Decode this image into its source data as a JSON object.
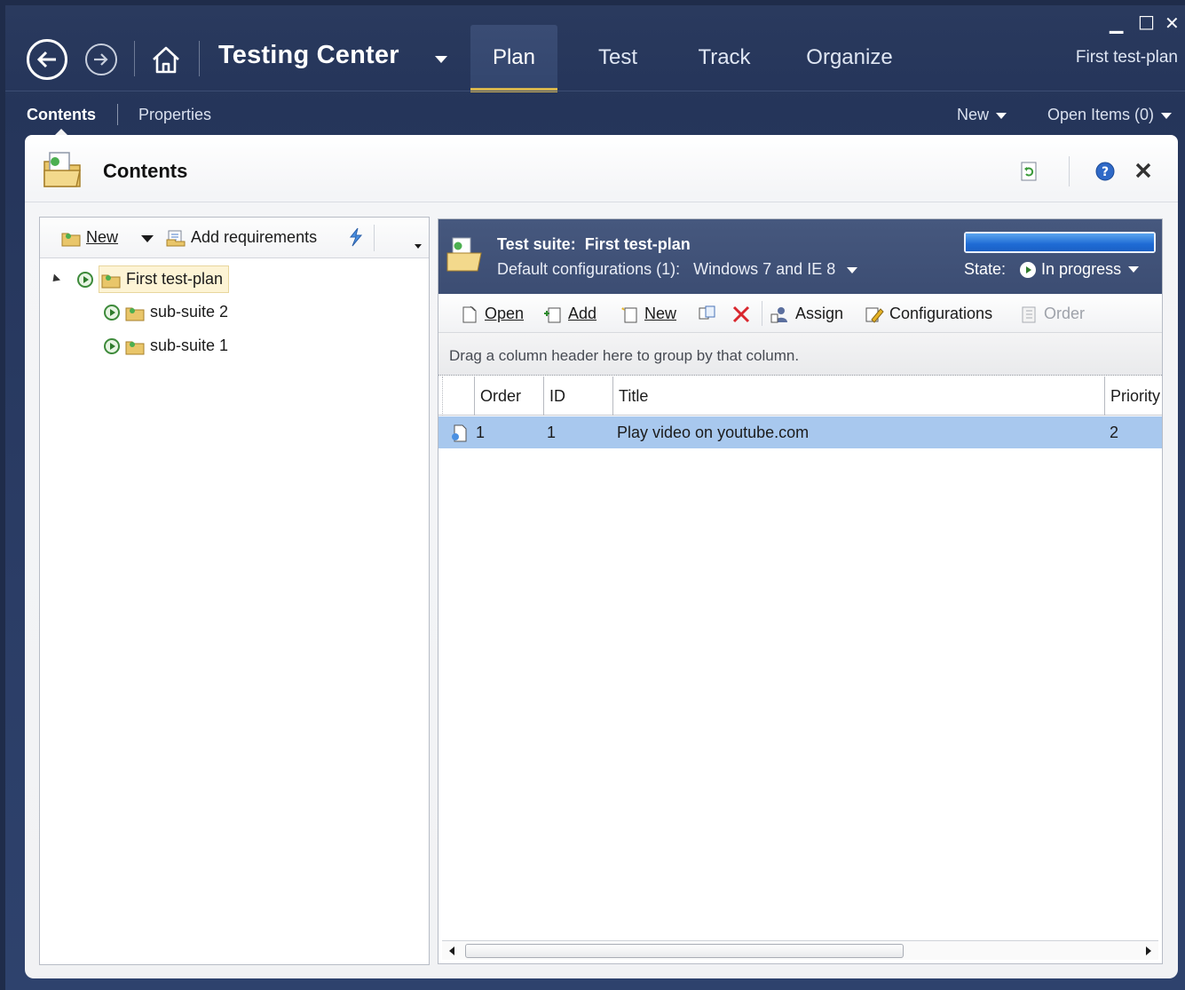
{
  "app": {
    "title": "Testing Center",
    "plan_name": "First test-plan",
    "window_controls": {
      "minimize": "▁",
      "maximize": "□",
      "close": "✕"
    }
  },
  "main_tabs": [
    {
      "label": "Plan",
      "active": true
    },
    {
      "label": "Test",
      "active": false
    },
    {
      "label": "Track",
      "active": false
    },
    {
      "label": "Organize",
      "active": false
    }
  ],
  "subnav": {
    "contents": "Contents",
    "properties": "Properties",
    "new": "New",
    "open_items": "Open Items (0)"
  },
  "panel": {
    "title": "Contents"
  },
  "left_toolbar": {
    "new": "New",
    "add_requirements": "Add requirements"
  },
  "tree": {
    "root": "First test-plan",
    "children": [
      "sub-suite 2",
      "sub-suite 1"
    ]
  },
  "suite": {
    "title_label": "Test suite:",
    "title_value": "First test-plan",
    "config_label": "Default configurations (1):",
    "config_value": "Windows 7 and IE 8",
    "state_label": "State:",
    "state_value": "In progress",
    "progress": 1.0
  },
  "right_toolbar": {
    "open": "Open",
    "add": "Add",
    "new": "New",
    "assign": "Assign",
    "configurations": "Configurations",
    "order": "Order"
  },
  "grid": {
    "group_hint": "Drag a column header here to group by that column.",
    "columns": [
      "Order",
      "ID",
      "Title",
      "Priority"
    ],
    "rows": [
      {
        "order": "1",
        "id": "1",
        "title": "Play video on youtube.com",
        "priority": "2"
      }
    ]
  },
  "colors": {
    "chrome": "#25355a",
    "accent": "#d7b64e",
    "selection": "#a8c8ee",
    "progress": "#1f6bd4"
  }
}
